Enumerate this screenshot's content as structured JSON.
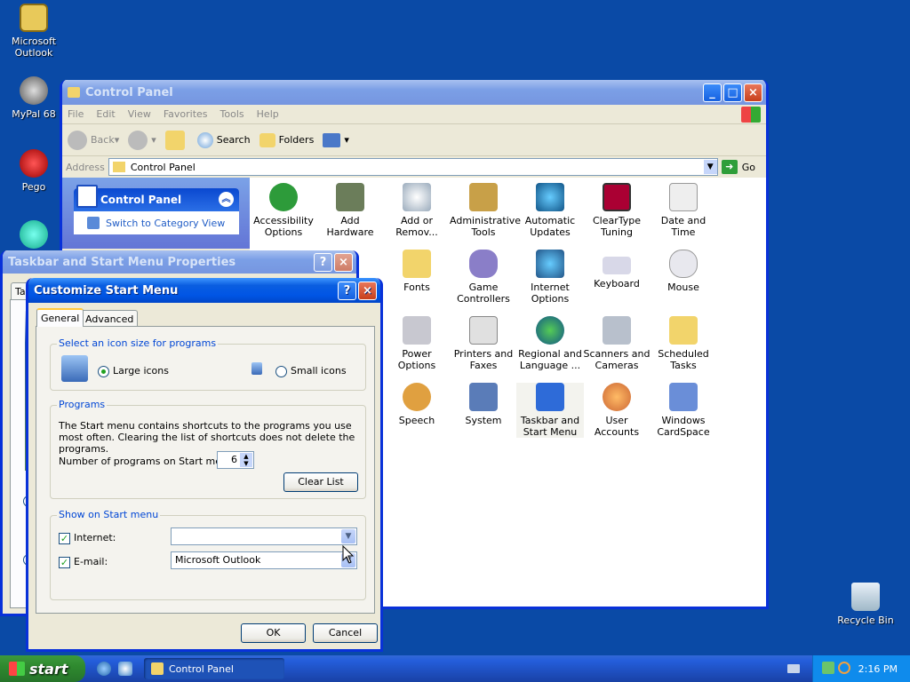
{
  "desktop": {
    "icons": [
      {
        "label": "Microsoft Outlook"
      },
      {
        "label": "MyPal 68"
      },
      {
        "label": "Pego"
      },
      {
        "label": "Recycle Bin"
      }
    ]
  },
  "control_panel": {
    "title": "Control Panel",
    "menu": [
      "File",
      "Edit",
      "View",
      "Favorites",
      "Tools",
      "Help"
    ],
    "toolbar": {
      "back": "Back",
      "search": "Search",
      "folders": "Folders"
    },
    "address_label": "Address",
    "address_value": "Control Panel",
    "go_label": "Go",
    "side": {
      "title": "Control Panel",
      "switch_link": "Switch to Category View"
    },
    "items": [
      "Accessibility Options",
      "Add Hardware",
      "Add or Remov...",
      "Administrative Tools",
      "Automatic Updates",
      "ClearType Tuning",
      "Date and Time",
      "Fonts",
      "Game Controllers",
      "Internet Options",
      "Keyboard",
      "Mouse",
      "Power Options",
      "Printers and Faxes",
      "Regional and Language ...",
      "Scanners and Cameras",
      "Scheduled Tasks",
      "Speech",
      "System",
      "Taskbar and Start Menu",
      "User Accounts",
      "Windows CardSpace"
    ]
  },
  "taskbar_props": {
    "title": "Taskbar and Start Menu Properties",
    "tab_partial": "Ta"
  },
  "customize": {
    "title": "Customize Start Menu",
    "tabs": [
      "General",
      "Advanced"
    ],
    "icon_size": {
      "legend": "Select an icon size for programs",
      "large": "Large icons",
      "small": "Small icons"
    },
    "programs": {
      "legend": "Programs",
      "description": "The Start menu contains shortcuts to the programs you use most often. Clearing the list of shortcuts does not delete the programs.",
      "count_label": "Number of programs on Start menu:",
      "count_value": "6",
      "clear_button": "Clear List"
    },
    "show": {
      "legend": "Show on Start menu",
      "internet_label": "Internet:",
      "internet_value": "",
      "email_label": "E-mail:",
      "email_value": "Microsoft Outlook"
    },
    "ok": "OK",
    "cancel": "Cancel"
  },
  "taskbar": {
    "start": "start",
    "task": "Control Panel",
    "clock": "2:16 PM"
  }
}
